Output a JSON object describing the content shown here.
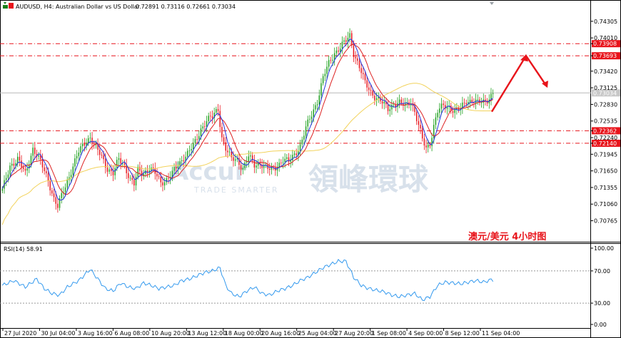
{
  "header": {
    "symbol": "AUDUSD, H4:  Australian Dollar vs US Dollar",
    "ohlc": "0.72891 0.73116 0.72661 0.73034"
  },
  "watermark": {
    "brand": "Accur",
    "tagline": "TRADE SMARTER",
    "cn": "領峰環球"
  },
  "annotation": "澳元/美元   4小时图",
  "colors": {
    "bull": "#1ea01e",
    "bear": "#e8141b",
    "ma_fast": "#2233dd",
    "ma_mid": "#dd2222",
    "ma_slow": "#f2d25a",
    "rsi": "#3399ee",
    "level": "#e8141b"
  },
  "chart_data": [
    {
      "type": "candlestick",
      "y_ticks": [
        "0.74305",
        "0.74010",
        "0.73908",
        "0.73693",
        "0.73420",
        "0.73125",
        "0.72830",
        "0.72535",
        "0.72362",
        "0.72240",
        "0.72140",
        "0.71945",
        "0.71650",
        "0.71355",
        "0.71060",
        "0.70765"
      ],
      "ylim": [
        0.7062,
        0.7443
      ],
      "x_ticks": [
        "27 Jul 2020",
        "30 Jul 04:00",
        "3 Aug 16:00",
        "6 Aug 08:00",
        "10 Aug 20:00",
        "13 Aug 12:00",
        "18 Aug 00:00",
        "20 Aug 16:00",
        "25 Aug 04:00",
        "27 Aug 20:00",
        "1 Sep 08:00",
        "4 Sep 00:00",
        "8 Sep 12:00",
        "11 Sep 04:00"
      ],
      "levels": [
        {
          "price": 0.73908,
          "label": "0.73908"
        },
        {
          "price": 0.73693,
          "label": "0.73693"
        },
        {
          "price": 0.72362,
          "label": "0.72362"
        },
        {
          "price": 0.7214,
          "label": "0.72140"
        }
      ],
      "current_price": {
        "price": 0.73034,
        "label": "0.73034"
      },
      "anchors": [
        [
          0,
          0.713
        ],
        [
          4,
          0.7175
        ],
        [
          8,
          0.7185
        ],
        [
          12,
          0.716
        ],
        [
          16,
          0.7205
        ],
        [
          20,
          0.718
        ],
        [
          24,
          0.715
        ],
        [
          27,
          0.7115
        ],
        [
          29,
          0.71
        ],
        [
          32,
          0.713
        ],
        [
          36,
          0.7165
        ],
        [
          40,
          0.7198
        ],
        [
          44,
          0.722
        ],
        [
          46,
          0.7225
        ],
        [
          48,
          0.721
        ],
        [
          52,
          0.719
        ],
        [
          55,
          0.717
        ],
        [
          58,
          0.716
        ],
        [
          61,
          0.7185
        ],
        [
          64,
          0.7175
        ],
        [
          67,
          0.715
        ],
        [
          69,
          0.714
        ],
        [
          71,
          0.7165
        ],
        [
          74,
          0.7162
        ],
        [
          77,
          0.717
        ],
        [
          80,
          0.716
        ],
        [
          83,
          0.7145
        ],
        [
          86,
          0.715
        ],
        [
          89,
          0.716
        ],
        [
          92,
          0.7175
        ],
        [
          95,
          0.719
        ],
        [
          98,
          0.72
        ],
        [
          101,
          0.7215
        ],
        [
          104,
          0.724
        ],
        [
          107,
          0.7255
        ],
        [
          110,
          0.726
        ],
        [
          112,
          0.727
        ],
        [
          113,
          0.7275
        ],
        [
          115,
          0.7225
        ],
        [
          117,
          0.7205
        ],
        [
          120,
          0.7185
        ],
        [
          123,
          0.7185
        ],
        [
          126,
          0.717
        ],
        [
          129,
          0.719
        ],
        [
          132,
          0.7175
        ],
        [
          135,
          0.718
        ],
        [
          138,
          0.717
        ],
        [
          141,
          0.7165
        ],
        [
          144,
          0.7175
        ],
        [
          147,
          0.7185
        ],
        [
          150,
          0.718
        ],
        [
          153,
          0.7195
        ],
        [
          156,
          0.721
        ],
        [
          159,
          0.724
        ],
        [
          162,
          0.7265
        ],
        [
          165,
          0.729
        ],
        [
          168,
          0.733
        ],
        [
          171,
          0.7355
        ],
        [
          174,
          0.7375
        ],
        [
          177,
          0.7385
        ],
        [
          180,
          0.7395
        ],
        [
          182,
          0.7405
        ],
        [
          184,
          0.7375
        ],
        [
          187,
          0.735
        ],
        [
          190,
          0.732
        ],
        [
          193,
          0.7305
        ],
        [
          196,
          0.7295
        ],
        [
          199,
          0.7285
        ],
        [
          202,
          0.7275
        ],
        [
          205,
          0.7285
        ],
        [
          208,
          0.7285
        ],
        [
          211,
          0.728
        ],
        [
          214,
          0.729
        ],
        [
          216,
          0.727
        ],
        [
          218,
          0.7245
        ],
        [
          220,
          0.722
        ],
        [
          222,
          0.7205
        ],
        [
          224,
          0.7215
        ],
        [
          226,
          0.7245
        ],
        [
          228,
          0.727
        ],
        [
          231,
          0.728
        ],
        [
          234,
          0.728
        ],
        [
          237,
          0.727
        ],
        [
          240,
          0.7275
        ],
        [
          243,
          0.729
        ],
        [
          246,
          0.729
        ],
        [
          249,
          0.7285
        ],
        [
          252,
          0.7288
        ],
        [
          255,
          0.7295
        ],
        [
          257,
          0.7303
        ]
      ],
      "forecast_arrow": [
        [
          0.727
        ],
        [
          0.73693
        ],
        [
          0.7315
        ]
      ]
    },
    {
      "type": "line",
      "title": "RSI(14) 58.91",
      "y_ticks": [
        "100.00",
        "70.00",
        "30.00",
        "0.00"
      ],
      "ylim": [
        0,
        100
      ],
      "levels": [
        70,
        30
      ],
      "anchors": [
        [
          0,
          52
        ],
        [
          6,
          58
        ],
        [
          12,
          50
        ],
        [
          18,
          60
        ],
        [
          22,
          48
        ],
        [
          26,
          42
        ],
        [
          30,
          40
        ],
        [
          34,
          50
        ],
        [
          40,
          58
        ],
        [
          46,
          72
        ],
        [
          50,
          60
        ],
        [
          54,
          48
        ],
        [
          58,
          45
        ],
        [
          62,
          55
        ],
        [
          66,
          50
        ],
        [
          70,
          48
        ],
        [
          74,
          55
        ],
        [
          78,
          52
        ],
        [
          82,
          48
        ],
        [
          86,
          50
        ],
        [
          90,
          52
        ],
        [
          94,
          58
        ],
        [
          98,
          60
        ],
        [
          102,
          64
        ],
        [
          106,
          68
        ],
        [
          110,
          70
        ],
        [
          114,
          74
        ],
        [
          117,
          52
        ],
        [
          120,
          42
        ],
        [
          124,
          38
        ],
        [
          128,
          45
        ],
        [
          132,
          50
        ],
        [
          136,
          42
        ],
        [
          140,
          40
        ],
        [
          144,
          45
        ],
        [
          148,
          48
        ],
        [
          152,
          52
        ],
        [
          156,
          58
        ],
        [
          160,
          62
        ],
        [
          164,
          68
        ],
        [
          168,
          74
        ],
        [
          172,
          78
        ],
        [
          176,
          82
        ],
        [
          180,
          82
        ],
        [
          184,
          62
        ],
        [
          188,
          52
        ],
        [
          192,
          48
        ],
        [
          196,
          46
        ],
        [
          200,
          44
        ],
        [
          204,
          40
        ],
        [
          208,
          38
        ],
        [
          212,
          40
        ],
        [
          216,
          42
        ],
        [
          220,
          34
        ],
        [
          224,
          38
        ],
        [
          228,
          52
        ],
        [
          232,
          56
        ],
        [
          236,
          55
        ],
        [
          240,
          54
        ],
        [
          244,
          56
        ],
        [
          248,
          58
        ],
        [
          252,
          56
        ],
        [
          256,
          59
        ]
      ]
    }
  ]
}
